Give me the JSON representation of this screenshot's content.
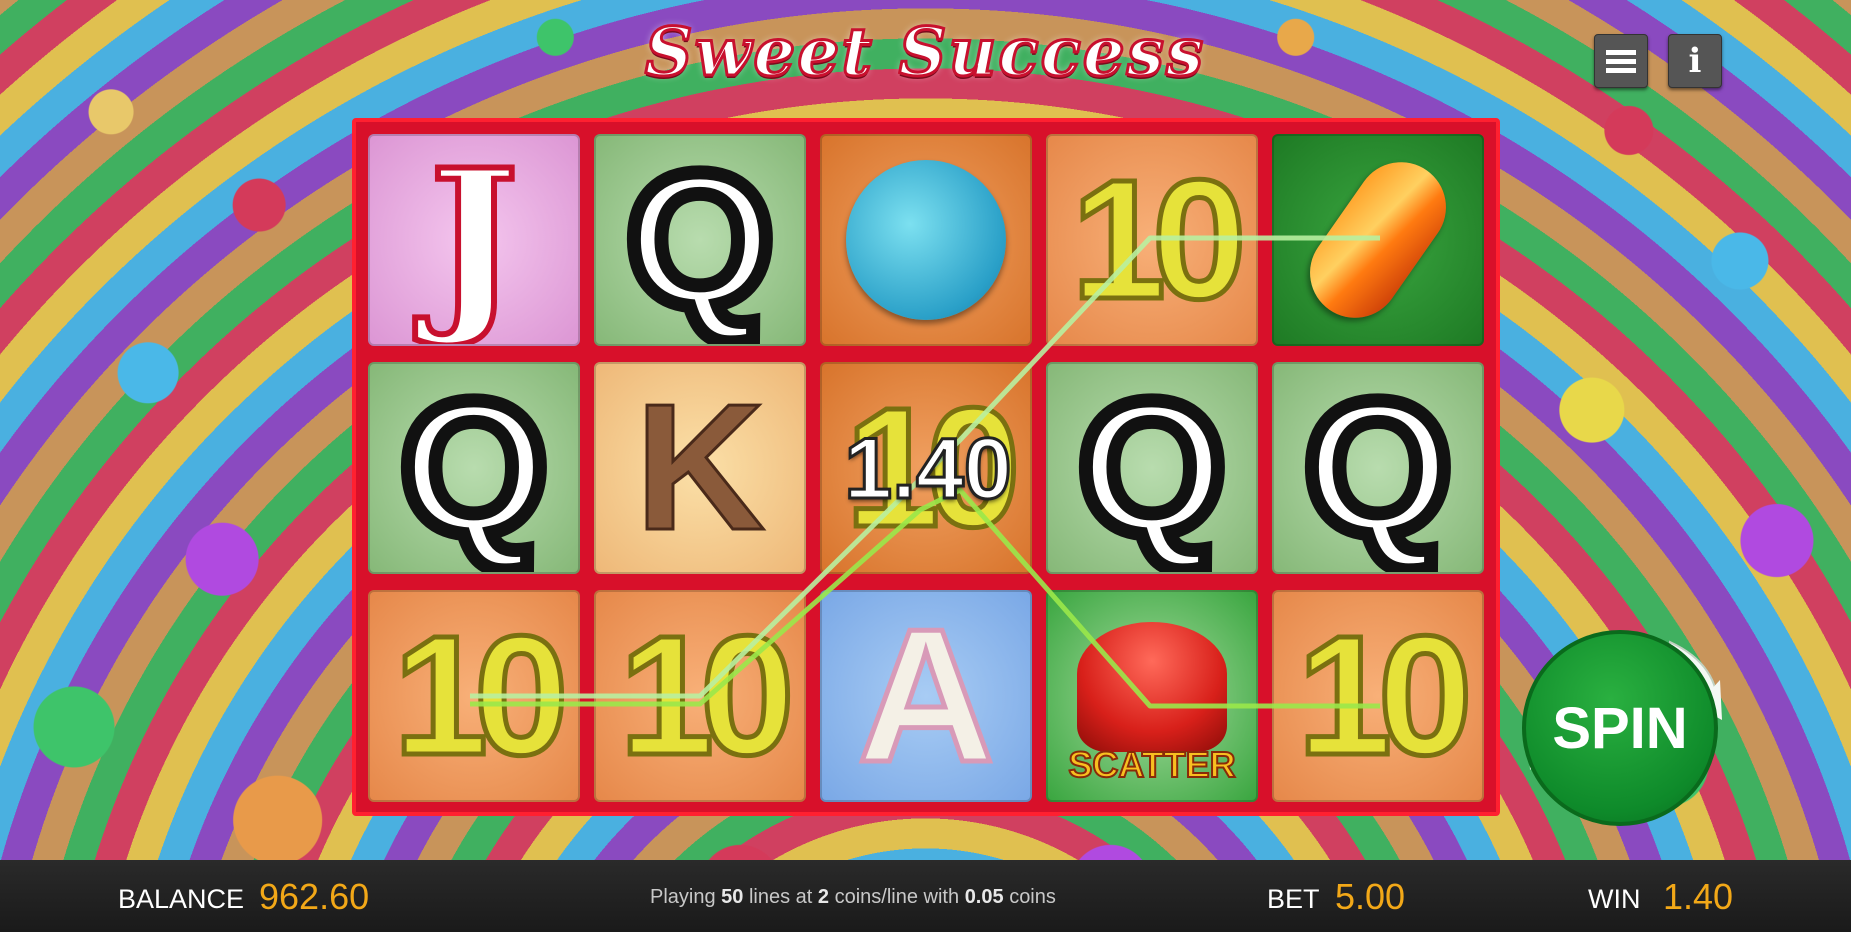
{
  "title": "Sweet Success",
  "reels": [
    [
      {
        "symbol": "J",
        "bg": "pink"
      },
      {
        "symbol": "Q",
        "bg": "green"
      },
      {
        "symbol": "10",
        "bg": "salmon"
      }
    ],
    [
      {
        "symbol": "Q",
        "bg": "green"
      },
      {
        "symbol": "K",
        "bg": "peach"
      },
      {
        "symbol": "10",
        "bg": "salmon"
      }
    ],
    [
      {
        "symbol": "blue-sweet",
        "bg": "orange"
      },
      {
        "symbol": "10",
        "bg": "orange"
      },
      {
        "symbol": "A",
        "bg": "blue"
      }
    ],
    [
      {
        "symbol": "10",
        "bg": "salmon"
      },
      {
        "symbol": "Q",
        "bg": "green"
      },
      {
        "symbol": "jelly-scatter",
        "bg": "sgreen"
      }
    ],
    [
      {
        "symbol": "orange-candy",
        "bg": "dgreen"
      },
      {
        "symbol": "Q",
        "bg": "green"
      },
      {
        "symbol": "10",
        "bg": "salmon"
      }
    ]
  ],
  "symbols": {
    "J": "J",
    "Q": "Q",
    "K": "K",
    "A": "A",
    "ten": "10",
    "scatter": "SCATTER"
  },
  "win_amount": "1.40",
  "spin_label": "SPIN",
  "bottom": {
    "balance_label": "BALANCE",
    "balance_value": "962.60",
    "playing_prefix": "Playing",
    "lines": "50",
    "lines_text": "lines at",
    "coins_per_line": "2",
    "coins_line_text": "coins/line with",
    "coin_value": "0.05",
    "coins_text": "coins",
    "bet_label": "BET",
    "bet_value": "5.00",
    "win_label": "WIN",
    "win_value": "1.40"
  },
  "colors": {
    "frame": "#d8102a",
    "win_line": "#9ae84a",
    "value_accent": "#f2a818",
    "spin_green": "#0e8a2a"
  }
}
